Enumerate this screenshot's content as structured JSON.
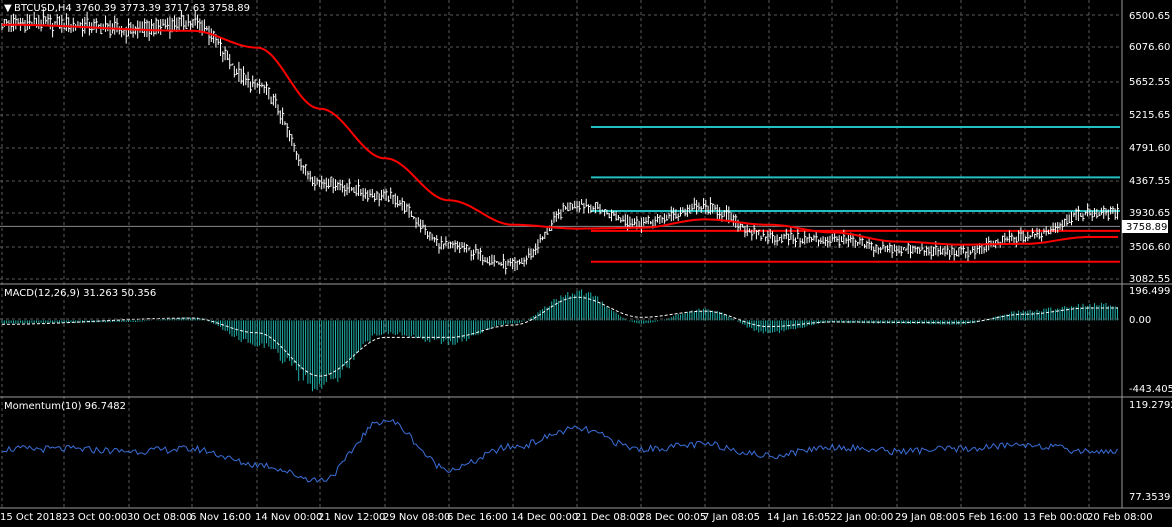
{
  "title": {
    "arrow": "▼",
    "symbol": "BTCUSD,H4",
    "ohlc": "3760.39 3773.39 3717.63 3758.89"
  },
  "colors": {
    "background": "#000000",
    "grid": "#5a5a5a",
    "bars": "#ffffff",
    "moving_average": "#ff0000",
    "hlines_cyan": "#20c0c0",
    "hlines_red": "#ff0000",
    "histogram": "#20b2aa",
    "signal": "#ffffff",
    "momentum": "#3a6ed8",
    "text": "#ffffff"
  },
  "price_pane": {
    "price_labels": [
      "6500.65",
      "6076.60",
      "5652.55",
      "5215.65",
      "4791.60",
      "4367.55",
      "3930.65",
      "3506.60",
      "3082.55"
    ],
    "current_price": "3758.89"
  },
  "macd_pane": {
    "title": "MACD(12,26,9) 31.263 50.356",
    "labels": [
      "196.499",
      "0.00",
      "-443.405"
    ]
  },
  "momentum_pane": {
    "title": "Momentum(10) 96.7482",
    "labels": [
      "119.2792",
      "77.3539"
    ]
  },
  "time_labels": [
    "15 Oct 2018",
    "23 Oct 00:00",
    "30 Oct 08:00",
    "6 Nov 16:00",
    "14 Nov 00:00",
    "21 Nov 12:00",
    "29 Nov 08:00",
    "6 Dec 16:00",
    "14 Dec 00:00",
    "21 Dec 08:00",
    "28 Dec 00:05",
    "7 Jan 08:05",
    "14 Jan 16:05",
    "22 Jan 00:00",
    "29 Jan 08:00",
    "5 Feb 16:00",
    "13 Feb 00:00",
    "20 Feb 08:00"
  ],
  "chart_data": [
    {
      "type": "candlestick",
      "title": "BTCUSD,H4",
      "ylim": [
        3082.55,
        6500.65
      ],
      "price_keypoints": [
        {
          "x": "15 Oct 2018",
          "close": 6420
        },
        {
          "x": "23 Oct 00:00",
          "close": 6410
        },
        {
          "x": "30 Oct 08:00",
          "close": 6330
        },
        {
          "x": "6 Nov 16:00",
          "close": 6430
        },
        {
          "x": "14 Nov 00:00",
          "close": 5600
        },
        {
          "x": "21 Nov 12:00",
          "close": 4350
        },
        {
          "x": "29 Nov 08:00",
          "close": 4150
        },
        {
          "x": "6 Dec 16:00",
          "close": 3500
        },
        {
          "x": "14 Dec 00:00",
          "close": 3250
        },
        {
          "x": "21 Dec 08:00",
          "close": 4050
        },
        {
          "x": "28 Dec 00:05",
          "close": 3800
        },
        {
          "x": "7 Jan 08:05",
          "close": 4000
        },
        {
          "x": "14 Jan 16:05",
          "close": 3620
        },
        {
          "x": "22 Jan 00:00",
          "close": 3580
        },
        {
          "x": "29 Jan 08:00",
          "close": 3460
        },
        {
          "x": "5 Feb 16:00",
          "close": 3420
        },
        {
          "x": "13 Feb 00:00",
          "close": 3620
        },
        {
          "x": "20 Feb 08:00",
          "close": 3930
        }
      ],
      "moving_average_keypoints": [
        {
          "x": "15 Oct 2018",
          "value": 6400
        },
        {
          "x": "6 Nov 16:00",
          "value": 6320
        },
        {
          "x": "14 Nov 00:00",
          "value": 6100
        },
        {
          "x": "21 Nov 12:00",
          "value": 5300
        },
        {
          "x": "29 Nov 08:00",
          "value": 4650
        },
        {
          "x": "6 Dec 16:00",
          "value": 4100
        },
        {
          "x": "14 Dec 00:00",
          "value": 3780
        },
        {
          "x": "21 Dec 08:00",
          "value": 3730
        },
        {
          "x": "28 Dec 00:05",
          "value": 3740
        },
        {
          "x": "7 Jan 08:05",
          "value": 3850
        },
        {
          "x": "14 Jan 16:05",
          "value": 3780
        },
        {
          "x": "22 Jan 00:00",
          "value": 3680
        },
        {
          "x": "29 Jan 08:00",
          "value": 3560
        },
        {
          "x": "5 Feb 16:00",
          "value": 3520
        },
        {
          "x": "13 Feb 00:00",
          "value": 3530
        },
        {
          "x": "20 Feb 08:00",
          "value": 3620
        }
      ],
      "horizontal_lines": [
        {
          "price": 5060,
          "from": "21 Dec 08:00",
          "color": "cyan"
        },
        {
          "price": 4400,
          "from": "21 Dec 08:00",
          "color": "cyan"
        },
        {
          "price": 3960,
          "from": "21 Dec 08:00",
          "color": "cyan"
        },
        {
          "price": 3700,
          "from": "21 Dec 08:00",
          "color": "red"
        },
        {
          "price": 3295,
          "from": "21 Dec 08:00",
          "color": "red"
        },
        {
          "price": 3758.89,
          "from": "15 Oct 2018",
          "color": "gray"
        }
      ]
    },
    {
      "type": "bar",
      "title": "MACD(12,26,9) 31.263 50.356",
      "ylim": [
        -443.405,
        196.499
      ],
      "histogram_keypoints": [
        {
          "x": "15 Oct 2018",
          "value": -20
        },
        {
          "x": "23 Oct 00:00",
          "value": -15
        },
        {
          "x": "30 Oct 08:00",
          "value": -10
        },
        {
          "x": "6 Nov 16:00",
          "value": 20
        },
        {
          "x": "14 Nov 00:00",
          "value": -150
        },
        {
          "x": "21 Nov 12:00",
          "value": -420
        },
        {
          "x": "29 Nov 08:00",
          "value": -80
        },
        {
          "x": "6 Dec 16:00",
          "value": -140
        },
        {
          "x": "14 Dec 00:00",
          "value": -20
        },
        {
          "x": "21 Dec 08:00",
          "value": 185
        },
        {
          "x": "28 Dec 00:05",
          "value": -20
        },
        {
          "x": "7 Jan 08:05",
          "value": 70
        },
        {
          "x": "14 Jan 16:05",
          "value": -80
        },
        {
          "x": "22 Jan 00:00",
          "value": -15
        },
        {
          "x": "29 Jan 08:00",
          "value": -20
        },
        {
          "x": "5 Feb 16:00",
          "value": -25
        },
        {
          "x": "13 Feb 00:00",
          "value": 60
        },
        {
          "x": "20 Feb 08:00",
          "value": 100
        }
      ],
      "signal_keypoints": [
        {
          "x": "15 Oct 2018",
          "value": -25
        },
        {
          "x": "6 Nov 16:00",
          "value": 15
        },
        {
          "x": "14 Nov 00:00",
          "value": -80
        },
        {
          "x": "21 Nov 12:00",
          "value": -360
        },
        {
          "x": "29 Nov 08:00",
          "value": -110
        },
        {
          "x": "6 Dec 16:00",
          "value": -110
        },
        {
          "x": "14 Dec 00:00",
          "value": -30
        },
        {
          "x": "21 Dec 08:00",
          "value": 150
        },
        {
          "x": "28 Dec 00:05",
          "value": 20
        },
        {
          "x": "7 Jan 08:05",
          "value": 60
        },
        {
          "x": "14 Jan 16:05",
          "value": -40
        },
        {
          "x": "22 Jan 00:00",
          "value": -10
        },
        {
          "x": "5 Feb 16:00",
          "value": -15
        },
        {
          "x": "13 Feb 00:00",
          "value": 40
        },
        {
          "x": "20 Feb 08:00",
          "value": 80
        }
      ]
    },
    {
      "type": "line",
      "title": "Momentum(10) 96.7482",
      "ylim": [
        77.3539,
        119.2792
      ],
      "keypoints": [
        {
          "x": "15 Oct 2018",
          "value": 99
        },
        {
          "x": "23 Oct 00:00",
          "value": 99
        },
        {
          "x": "30 Oct 08:00",
          "value": 98
        },
        {
          "x": "6 Nov 16:00",
          "value": 99
        },
        {
          "x": "14 Nov 00:00",
          "value": 92
        },
        {
          "x": "21 Nov 12:00",
          "value": 85
        },
        {
          "x": "29 Nov 08:00",
          "value": 112
        },
        {
          "x": "6 Dec 16:00",
          "value": 90
        },
        {
          "x": "14 Dec 00:00",
          "value": 100
        },
        {
          "x": "21 Dec 08:00",
          "value": 108
        },
        {
          "x": "28 Dec 00:05",
          "value": 99
        },
        {
          "x": "7 Jan 08:05",
          "value": 101
        },
        {
          "x": "14 Jan 16:05",
          "value": 96
        },
        {
          "x": "22 Jan 00:00",
          "value": 100
        },
        {
          "x": "29 Jan 08:00",
          "value": 98
        },
        {
          "x": "5 Feb 16:00",
          "value": 99
        },
        {
          "x": "13 Feb 00:00",
          "value": 101
        },
        {
          "x": "20 Feb 08:00",
          "value": 98
        }
      ]
    }
  ]
}
